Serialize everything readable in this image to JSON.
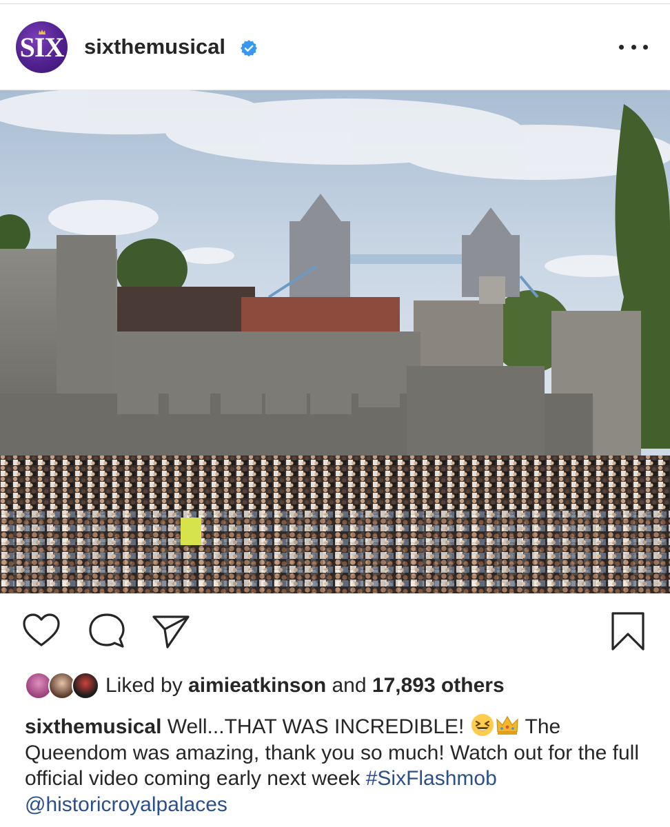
{
  "header": {
    "avatar_text": "SIX",
    "username": "sixthemusical",
    "verified": true,
    "more_icon": "more-horizontal-icon"
  },
  "photo": {
    "alt_label": ""
  },
  "actions": {
    "like_icon": "heart-icon",
    "comment_icon": "comment-icon",
    "share_icon": "send-icon",
    "save_icon": "bookmark-icon"
  },
  "likes": {
    "prefix": "Liked by ",
    "user": "aimieatkinson",
    "middle": " and ",
    "count": "17,893 others"
  },
  "caption": {
    "user": "sixthemusical",
    "text_1": " Well...THAT WAS INCREDIBLE! ",
    "emoji_1": "laughing-face-emoji",
    "emoji_2": "crown-emoji",
    "text_2": " The Queendom was amazing, thank you so much! Watch out for the full official video coming early next week ",
    "hashtag": "#SixFlashmob",
    "mention": "@historicroyalpalaces"
  },
  "colors": {
    "brand_purple": "#51218f",
    "verified_blue": "#3897f0",
    "link_blue": "#2c4f8a",
    "text": "#262626"
  }
}
